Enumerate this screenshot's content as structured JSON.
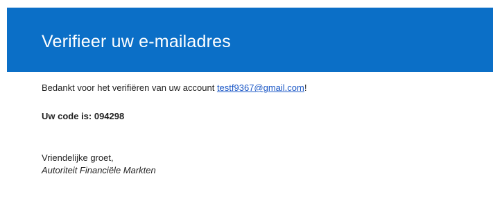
{
  "header": {
    "title": "Verifieer uw e-mailadres"
  },
  "body": {
    "intro_text": "Bedankt voor het verifiëren van uw account ",
    "email": "testf9367@gmail.com",
    "intro_suffix": "!",
    "code_line": "Uw code is: 094298",
    "greeting": "Vriendelijke groet,",
    "signature": "Autoriteit Financiële Markten"
  },
  "colors": {
    "header_bg": "#0b6fc7",
    "link": "#1a57c6"
  }
}
